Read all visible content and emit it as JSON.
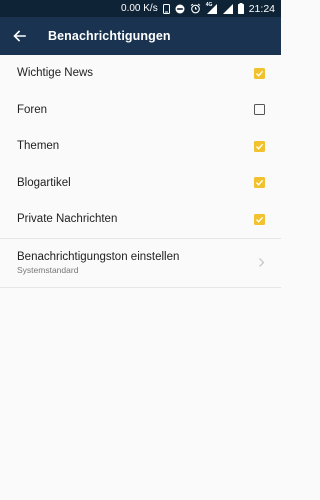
{
  "status_bar": {
    "speed": "0.00 K/s",
    "network_label": "4G",
    "time": "21:24"
  },
  "app_bar": {
    "title": "Benachrichtigungen",
    "back_icon": "arrow-left-icon"
  },
  "settings": [
    {
      "label": "Wichtige News",
      "checked": true
    },
    {
      "label": "Foren",
      "checked": false
    },
    {
      "label": "Themen",
      "checked": true
    },
    {
      "label": "Blogartikel",
      "checked": true
    },
    {
      "label": "Private Nachrichten",
      "checked": true
    }
  ],
  "sound": {
    "title": "Benachrichtigungston einstellen",
    "subtitle": "Systemstandard",
    "chevron_icon": "chevron-right-icon"
  },
  "colors": {
    "status_bar_bg": "#0f2336",
    "app_bar_bg": "#1a3350",
    "accent": "#f2c12e",
    "background": "#fafafa"
  }
}
